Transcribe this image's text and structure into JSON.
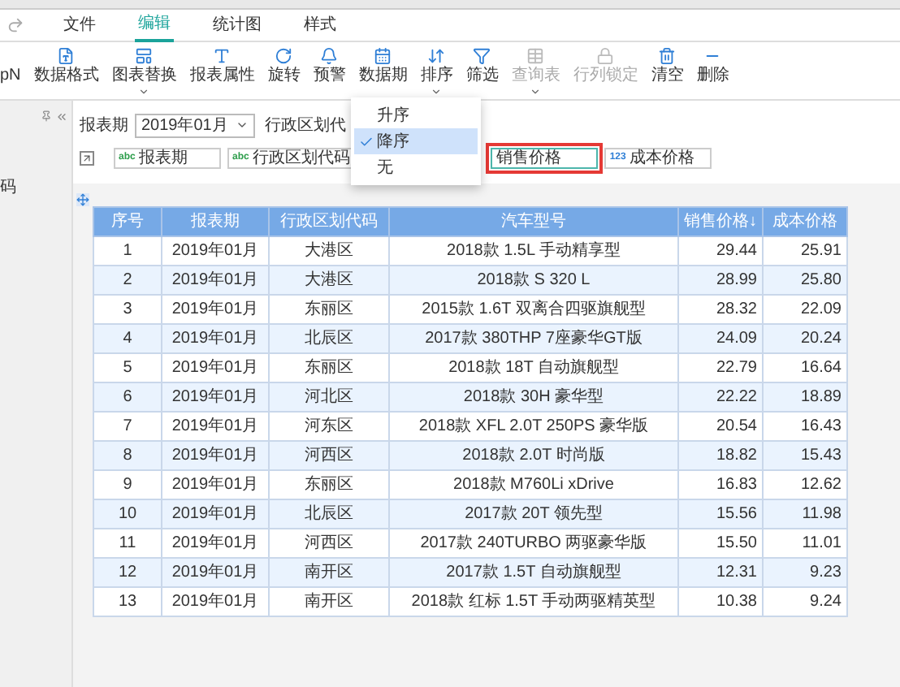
{
  "menu_tabs": [
    {
      "label": "文件",
      "selected": false
    },
    {
      "label": "编辑",
      "selected": true
    },
    {
      "label": "统计图",
      "selected": false
    },
    {
      "label": "样式",
      "selected": false
    }
  ],
  "toolbar": [
    {
      "label": "pN",
      "disabled": false,
      "dropdown": false
    },
    {
      "label": "数据格式",
      "disabled": false,
      "dropdown": false
    },
    {
      "label": "图表替换",
      "disabled": false,
      "dropdown": true
    },
    {
      "label": "报表属性",
      "disabled": false,
      "dropdown": false
    },
    {
      "label": "旋转",
      "disabled": false,
      "dropdown": false
    },
    {
      "label": "预警",
      "disabled": false,
      "dropdown": false
    },
    {
      "label": "数据期",
      "disabled": false,
      "dropdown": false
    },
    {
      "label": "排序",
      "disabled": false,
      "dropdown": true
    },
    {
      "label": "筛选",
      "disabled": false,
      "dropdown": false
    },
    {
      "label": "查询表",
      "disabled": true,
      "dropdown": true
    },
    {
      "label": "行列锁定",
      "disabled": true,
      "dropdown": false
    },
    {
      "label": "清空",
      "disabled": false,
      "dropdown": false
    },
    {
      "label": "删除",
      "disabled": false,
      "dropdown": false
    }
  ],
  "sidebar": {
    "text": "码"
  },
  "filter": {
    "label": "报表期",
    "value": "2019年01月",
    "label_2": "行政区划代"
  },
  "sort_menu": [
    {
      "label": "升序",
      "selected": false
    },
    {
      "label": "降序",
      "selected": true
    },
    {
      "label": "无",
      "selected": false
    }
  ],
  "fields": [
    {
      "kind": "text",
      "badge": "abc",
      "label": "报表期",
      "highlighted": false
    },
    {
      "kind": "text",
      "badge": "abc",
      "label": "行政区划代码",
      "highlighted": false
    },
    {
      "kind": "plain",
      "label": "销售价格",
      "highlighted": true
    },
    {
      "kind": "number",
      "badge": "123",
      "label": "成本价格",
      "highlighted": false
    }
  ],
  "table": {
    "columns": [
      "序号",
      "报表期",
      "行政区划代码",
      "汽车型号",
      "销售价格↓",
      "成本价格"
    ],
    "rows": [
      [
        "1",
        "2019年01月",
        "大港区",
        "2018款 1.5L 手动精享型",
        "29.44",
        "25.91"
      ],
      [
        "2",
        "2019年01月",
        "大港区",
        "2018款 S 320 L",
        "28.99",
        "25.80"
      ],
      [
        "3",
        "2019年01月",
        "东丽区",
        "2015款 1.6T 双离合四驱旗舰型",
        "28.32",
        "22.09"
      ],
      [
        "4",
        "2019年01月",
        "北辰区",
        "2017款 380THP 7座豪华GT版",
        "24.09",
        "20.24"
      ],
      [
        "5",
        "2019年01月",
        "东丽区",
        "2018款 18T 自动旗舰型",
        "22.79",
        "16.64"
      ],
      [
        "6",
        "2019年01月",
        "河北区",
        "2018款 30H 豪华型",
        "22.22",
        "18.89"
      ],
      [
        "7",
        "2019年01月",
        "河东区",
        "2018款 XFL 2.0T 250PS 豪华版",
        "20.54",
        "16.43"
      ],
      [
        "8",
        "2019年01月",
        "河西区",
        "2018款 2.0T 时尚版",
        "18.82",
        "15.43"
      ],
      [
        "9",
        "2019年01月",
        "东丽区",
        "2018款 M760Li xDrive",
        "16.83",
        "12.62"
      ],
      [
        "10",
        "2019年01月",
        "北辰区",
        "2017款 20T 领先型",
        "15.56",
        "11.98"
      ],
      [
        "11",
        "2019年01月",
        "河西区",
        "2017款 240TURBO 两驱豪华版",
        "15.50",
        "11.01"
      ],
      [
        "12",
        "2019年01月",
        "南开区",
        "2017款 1.5T 自动旗舰型",
        "12.31",
        "9.23"
      ],
      [
        "13",
        "2019年01月",
        "南开区",
        "2018款 红标 1.5T 手动两驱精英型",
        "10.38",
        "9.24"
      ]
    ]
  }
}
